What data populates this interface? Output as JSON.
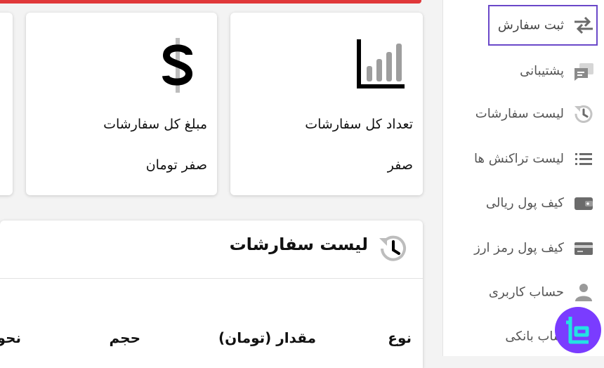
{
  "stats": {
    "order_count": {
      "title": "تعداد کل سفارشات",
      "value": "صفر"
    },
    "order_amount": {
      "title": "مبلغ کل سفارشات",
      "value": "صفر تومان"
    }
  },
  "orders": {
    "title": "لیست سفارشات",
    "columns": [
      "نوع",
      "مقدار (تومان)",
      "حجم",
      "نحو"
    ]
  },
  "sidebar": {
    "items": [
      {
        "label": "ثبت سفارش",
        "icon": "swap-arrows-icon"
      },
      {
        "label": "پشتیبانی",
        "icon": "chat-bubbles-icon"
      },
      {
        "label": "لیست سفارشات",
        "icon": "history-clock-icon"
      },
      {
        "label": "لیست تراکنش ها",
        "icon": "list-icon"
      },
      {
        "label": "کیف پول ریالی",
        "icon": "wallet-icon"
      },
      {
        "label": "کیف پول رمز ارز",
        "icon": "card-icon"
      },
      {
        "label": "حساب کاربری",
        "icon": "user-icon"
      },
      {
        "label": "ساب بانکی",
        "icon": "bank-icon"
      }
    ]
  },
  "colors": {
    "accent": "#6a48c9",
    "top_strip": "#e0383a",
    "badge": "#7a3cff"
  }
}
